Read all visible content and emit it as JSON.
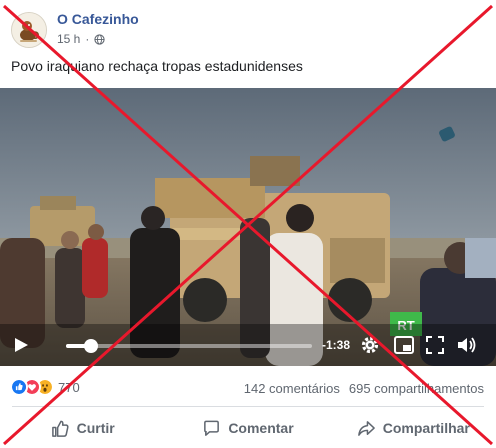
{
  "post": {
    "page_name": "O Cafezinho",
    "timestamp": "15 h",
    "caption": "Povo iraquiano rechaça tropas estadunidenses"
  },
  "video": {
    "time_remaining": "-1:38",
    "progress": 0.1,
    "overlay_logo_text": "RT"
  },
  "stats": {
    "reaction_count": "770",
    "comments": "142 comentários",
    "shares": "695 compartilhamentos"
  },
  "actions": {
    "like": "Curtir",
    "comment": "Comentar",
    "share": "Compartilhar"
  },
  "colors": {
    "link": "#385898",
    "secondary_text": "#606770",
    "cross": "#e8182c",
    "like_blue": "#1877f2",
    "love_red": "#f33e58",
    "wow_yellow": "#f7b125"
  }
}
